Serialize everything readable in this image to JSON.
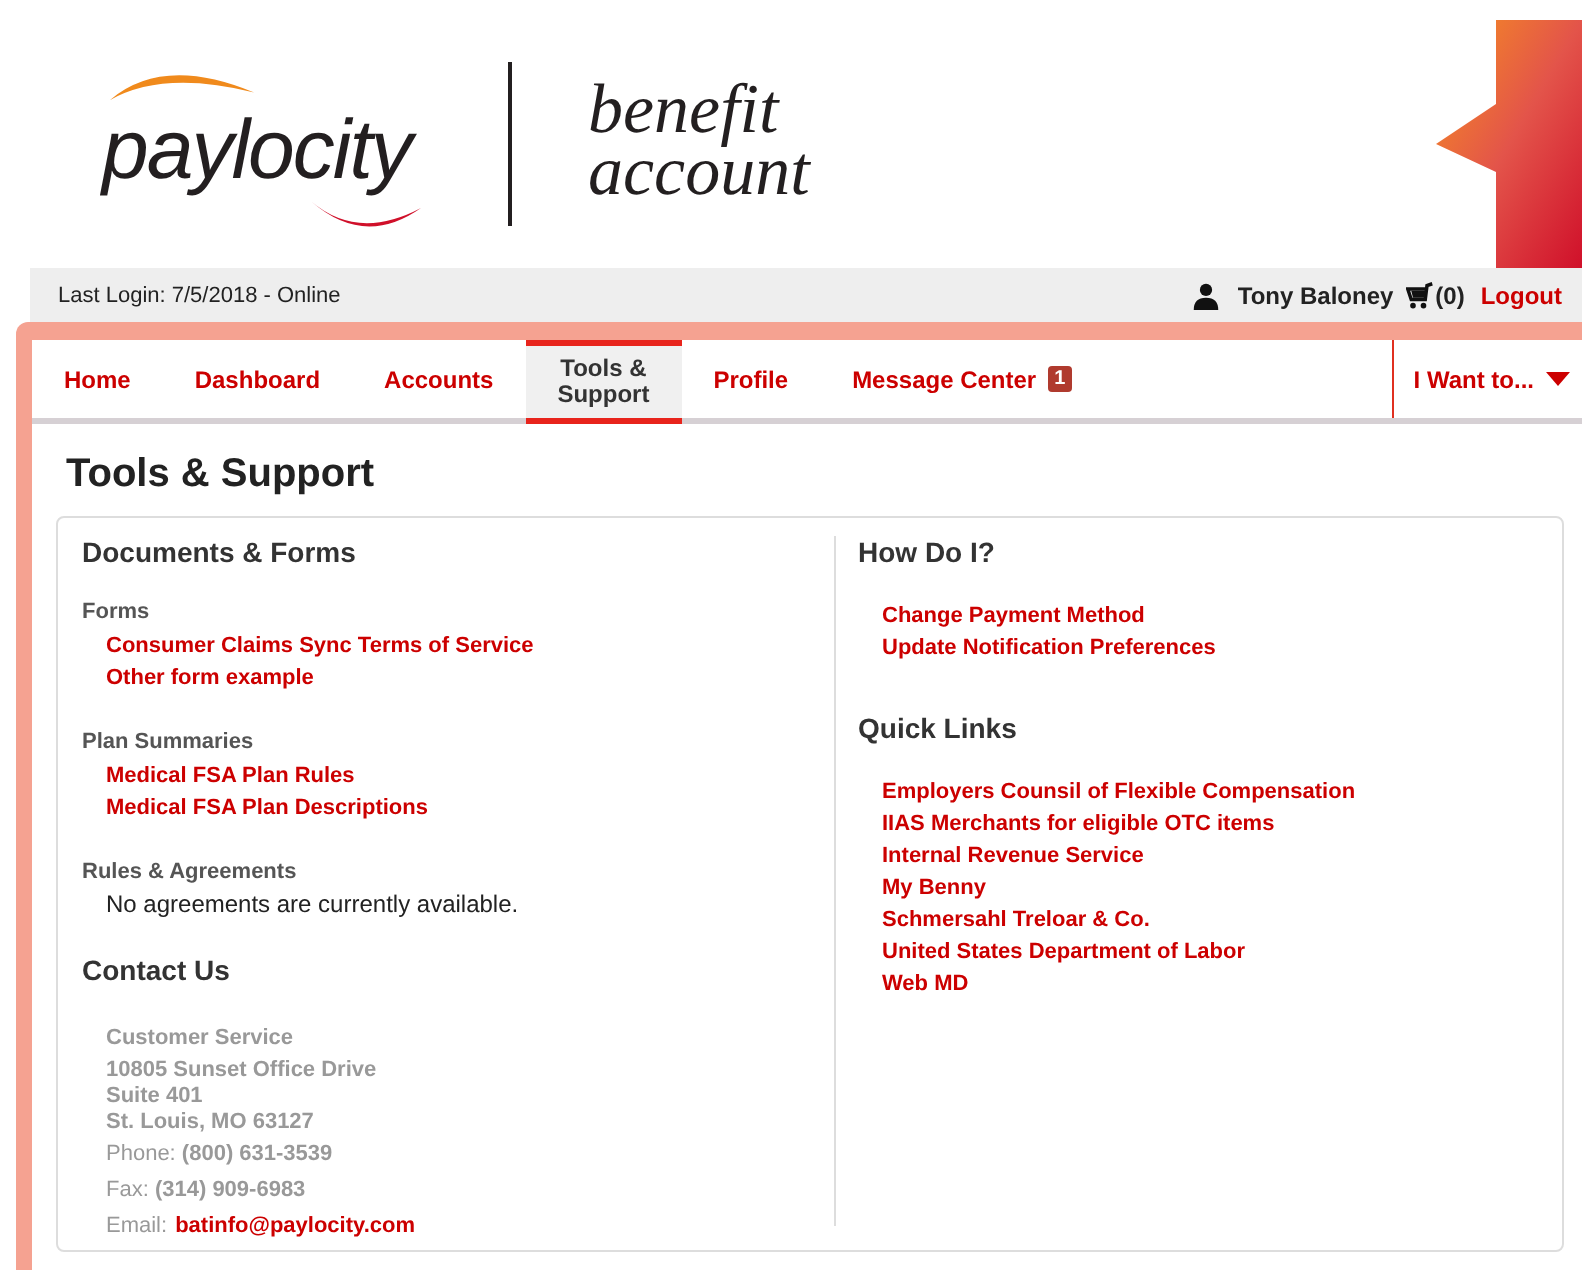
{
  "header": {
    "logo": "paylocity",
    "product": [
      "benefit",
      "account"
    ]
  },
  "status_bar": {
    "last_login": "Last Login: 7/5/2018 - Online",
    "user_name": "Tony Baloney",
    "cart_count": "(0)",
    "logout": "Logout"
  },
  "nav": {
    "tabs": [
      {
        "label": "Home",
        "selected": false
      },
      {
        "label": "Dashboard",
        "selected": false
      },
      {
        "label": "Accounts",
        "selected": false
      },
      {
        "label": "Tools & Support",
        "selected": true
      },
      {
        "label": "Profile",
        "selected": false
      },
      {
        "label": "Message Center",
        "selected": false,
        "badge": "1"
      }
    ],
    "menu": "I Want to..."
  },
  "page_title": "Tools & Support",
  "documents": {
    "title": "Documents & Forms",
    "groups": [
      {
        "title": "Forms",
        "links": [
          "Consumer Claims Sync Terms of Service",
          "Other form example"
        ]
      },
      {
        "title": "Plan Summaries",
        "links": [
          "Medical FSA Plan Rules",
          "Medical FSA Plan Descriptions"
        ]
      },
      {
        "title": "Rules & Agreements",
        "note": "No agreements are currently available."
      }
    ]
  },
  "contact": {
    "title": "Contact Us",
    "address": [
      "Customer Service",
      "10805 Sunset Office Drive",
      "Suite 401",
      "St. Louis, MO 63127"
    ],
    "phone": "Phone: **(800) 631-3539**",
    "fax": "Fax: **(314) 909-6983**",
    "email_label": "Email:",
    "email": "batinfo@paylocity.com"
  },
  "how_do_i": {
    "title": "How Do I?",
    "links": [
      "Change Payment Method",
      "Update Notification Preferences"
    ]
  },
  "quick_links": {
    "title": "Quick Links",
    "links": [
      "Employers Counsil of Flexible Compensation",
      "IIAS Merchants for eligible OTC items",
      "Internal Revenue Service",
      "My Benny",
      "Schmersahl Treloar & Co.",
      "United States Department of Labor",
      "Web MD"
    ]
  }
}
